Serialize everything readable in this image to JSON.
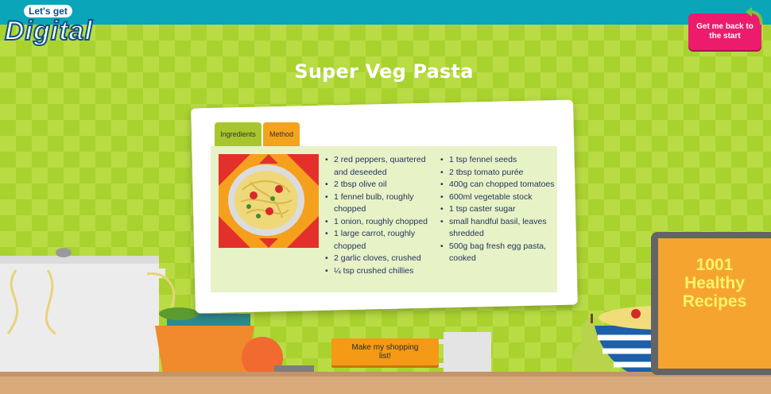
{
  "logo": {
    "line1": "Let's get",
    "line2": "Digital"
  },
  "back_button": {
    "label": "Get me back to the start"
  },
  "recipe": {
    "title": "Super Veg Pasta",
    "tabs": [
      {
        "label": "Ingredients",
        "active": true
      },
      {
        "label": "Method",
        "active": false
      }
    ],
    "ingredients_col1": [
      "2 red peppers, quartered and deseeded",
      "2 tbsp olive oil",
      "1 fennel bulb, roughly chopped",
      "1 onion, roughly chopped",
      "1 large carrot, roughly chopped",
      "2 garlic cloves, crushed",
      "¼ tsp crushed chillies"
    ],
    "ingredients_col2": [
      "1 tsp fennel seeds",
      "2 tbsp tomato purée",
      "400g can chopped tomatoes",
      "600ml vegetable stock",
      "1 tsp caster sugar",
      "small handful basil, leaves shredded",
      "500g bag fresh egg pasta, cooked"
    ]
  },
  "shopping_button": {
    "label": "Make my shopping list!"
  },
  "book": {
    "line1": "1001",
    "line2": "Healthy",
    "line3": "Recipes"
  },
  "colors": {
    "topbar": "#0aa5b8",
    "background": "#a9d22f",
    "back_button": "#ec1b6b",
    "shopping_button": "#f59a16",
    "ingredients_tab": "#a9c52c",
    "method_tab": "#f4a31c"
  },
  "icons": [
    "back-arrow-icon",
    "pasta-plate-image",
    "cooking-pot",
    "mixing-bowl",
    "pear",
    "mug"
  ]
}
